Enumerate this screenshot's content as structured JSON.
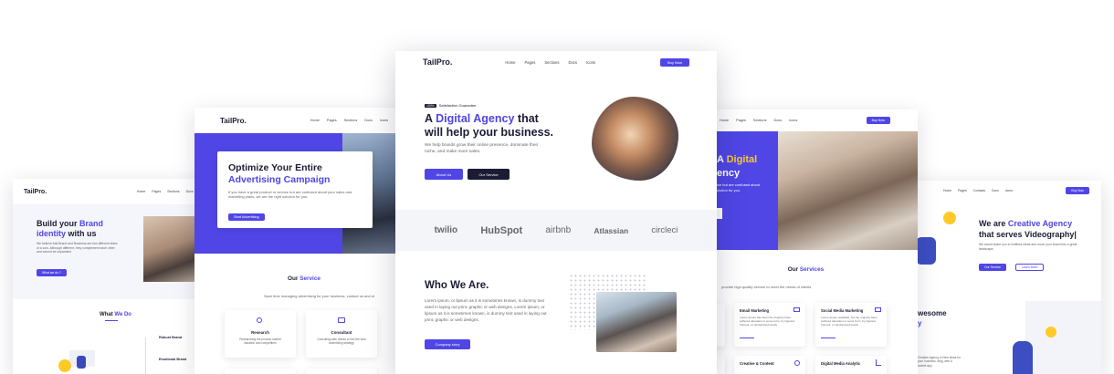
{
  "left_page": {
    "logo": "TailPro.",
    "menu": [
      "Home",
      "Pages",
      "Sections",
      "Docs",
      "Icons"
    ],
    "title_a": "Build your",
    "title_brand": "Brand",
    "title_b": "identity",
    "title_c": "with us",
    "desc": "We believe that Brand and Business are two different sides of a coin. Although different, they complement each other and cannot be separated.",
    "cta": "What we do ?",
    "section_title_a": "What",
    "section_title_b": "We Do",
    "items": [
      "Robust Brand",
      "Emotional Brand"
    ]
  },
  "mid_left_page": {
    "logo": "TailPro.",
    "menu": [
      "Home",
      "Pages",
      "Sections",
      "Docs",
      "Icons"
    ],
    "hero_title_a": "Optimize Your Entire",
    "hero_title_b": "Advertising Campaign",
    "hero_desc": "If you have a great product or service but are confused about your sales and marketing plans, we are the right solution for you.",
    "hero_btn": "Start Advertising",
    "svc_title_a": "Our",
    "svc_title_b": "Service",
    "svc_sub": "Save time managing advertising for your business, contact us and st",
    "cards": [
      {
        "title": "Research",
        "desc": "Researching the product market situation and competitors"
      },
      {
        "title": "Consultant",
        "desc": "Consulting with clients to find the best advertising strategy"
      }
    ]
  },
  "center_page": {
    "logo": "TailPro.",
    "menu": [
      "Home",
      "Pages",
      "Sections",
      "Docs",
      "Icons"
    ],
    "buy": "Buy Now",
    "badge": "100%",
    "badge_text": "Satisfaction Guarantee",
    "title_a": "A",
    "title_accent": "Digital Agency",
    "title_b": "that",
    "title_c": "will help your business.",
    "desc": "We help brands grow their online presence, dominate their niche, and make more sales.",
    "btn_about": "About Us",
    "btn_service": "Our Service",
    "brands": [
      "twilio",
      "HubSpot",
      "airbnb",
      "Atlassian",
      "circleci"
    ],
    "who_title": "Who We Are.",
    "who_desc": "Lorem ipsum, or lipsum as it is sometimes known, is dummy text used in laying out print, graphic or web designs. Lorem ipsum, or lipsum as it is sometimes known, is dummy text used in laying out print, graphic or web designs.",
    "who_btn": "Company story"
  },
  "mid_right_page": {
    "menu": [
      "Home",
      "Pages",
      "Sections",
      "Docs",
      "Icons"
    ],
    "buy": "Buy Now",
    "hero_a": "A",
    "hero_accent": "Digital",
    "hero_b": "ency",
    "hero_desc": "ice but are confused about olution for you.",
    "svc_title_a": "Our",
    "svc_title_b": "Services",
    "svc_sub": "provide high quality service to meet the needs of clients",
    "cards": [
      {
        "title": "Email Marketing",
        "desc": "Lorem Ipsum has been the majority have suffered alteration in some form, by injected humour, or randomised words"
      },
      {
        "title": "Social Media Marketing",
        "desc": "Lorem Ipsum available, but the majority have suffered alteration in some form, by injected humour, or randomised words"
      },
      {
        "title": "Creative & Content",
        "desc": ""
      },
      {
        "title": "Digital Media Analytic",
        "desc": ""
      }
    ]
  },
  "right_page": {
    "menu": [
      "Home",
      "Pages",
      "Contacts",
      "Docs",
      "Icons"
    ],
    "buy": "Buy Now",
    "title_a": "We are",
    "title_accent": "Creative Agency",
    "title_b": "that serves Videography|",
    "desc": "We would share you to limitless ideas and move your brand into a great landscape.",
    "btn_service": "Our Service",
    "btn_learn": "Learn More",
    "aw_a": "wesome",
    "aw_b": "y",
    "aw_desc": "Creative Agency in New ideas for your business. ding, web & mobile app"
  }
}
